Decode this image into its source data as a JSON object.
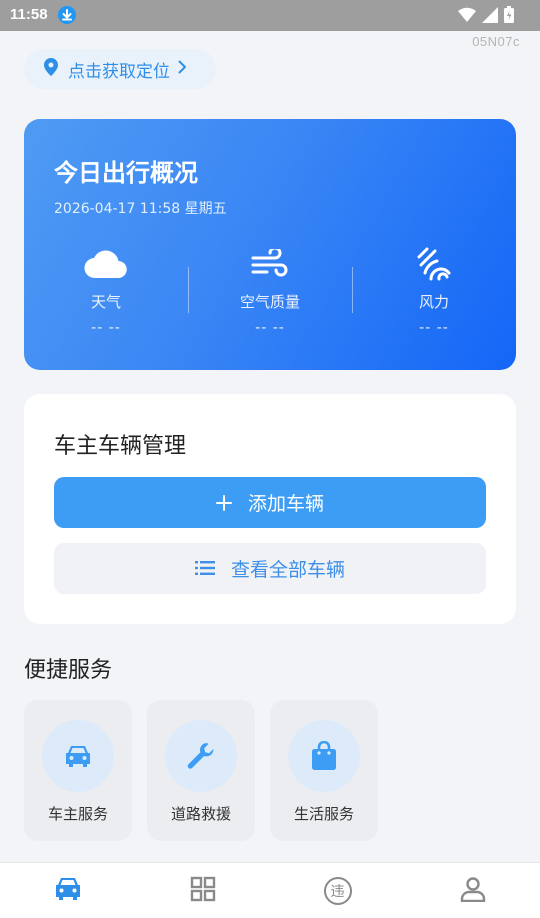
{
  "status_bar": {
    "time": "11:58"
  },
  "device_code": "05N07c",
  "location": {
    "label": "点击获取定位"
  },
  "overview": {
    "title": "今日出行概况",
    "datetime": "2026-04-17 11:58 星期五",
    "items": [
      {
        "icon": "cloud-icon",
        "label": "天气",
        "value": "-- --"
      },
      {
        "icon": "wind-icon",
        "label": "空气质量",
        "value": "-- --"
      },
      {
        "icon": "wind-force-icon",
        "label": "风力",
        "value": "-- --"
      }
    ]
  },
  "vehicle_card": {
    "title": "车主车辆管理",
    "add_label": "添加车辆",
    "view_all_label": "查看全部车辆"
  },
  "services": {
    "title": "便捷服务",
    "items": [
      {
        "icon": "car-icon",
        "label": "车主服务"
      },
      {
        "icon": "wrench-icon",
        "label": "道路救援"
      },
      {
        "icon": "shopping-bag-icon",
        "label": "生活服务"
      }
    ]
  },
  "tabbar": {
    "tabs": [
      {
        "icon": "car-tab-icon",
        "active": true
      },
      {
        "icon": "grid-tab-icon",
        "active": false
      },
      {
        "icon": "violation-tab-icon",
        "glyph": "违",
        "active": false
      },
      {
        "icon": "user-tab-icon",
        "active": false
      }
    ]
  },
  "colors": {
    "accent": "#3d9df5",
    "gradient_start": "#4f9bf3",
    "gradient_end": "#1466f7",
    "tab_active": "#2f8fe8",
    "tab_inactive": "#8a8a8a"
  }
}
